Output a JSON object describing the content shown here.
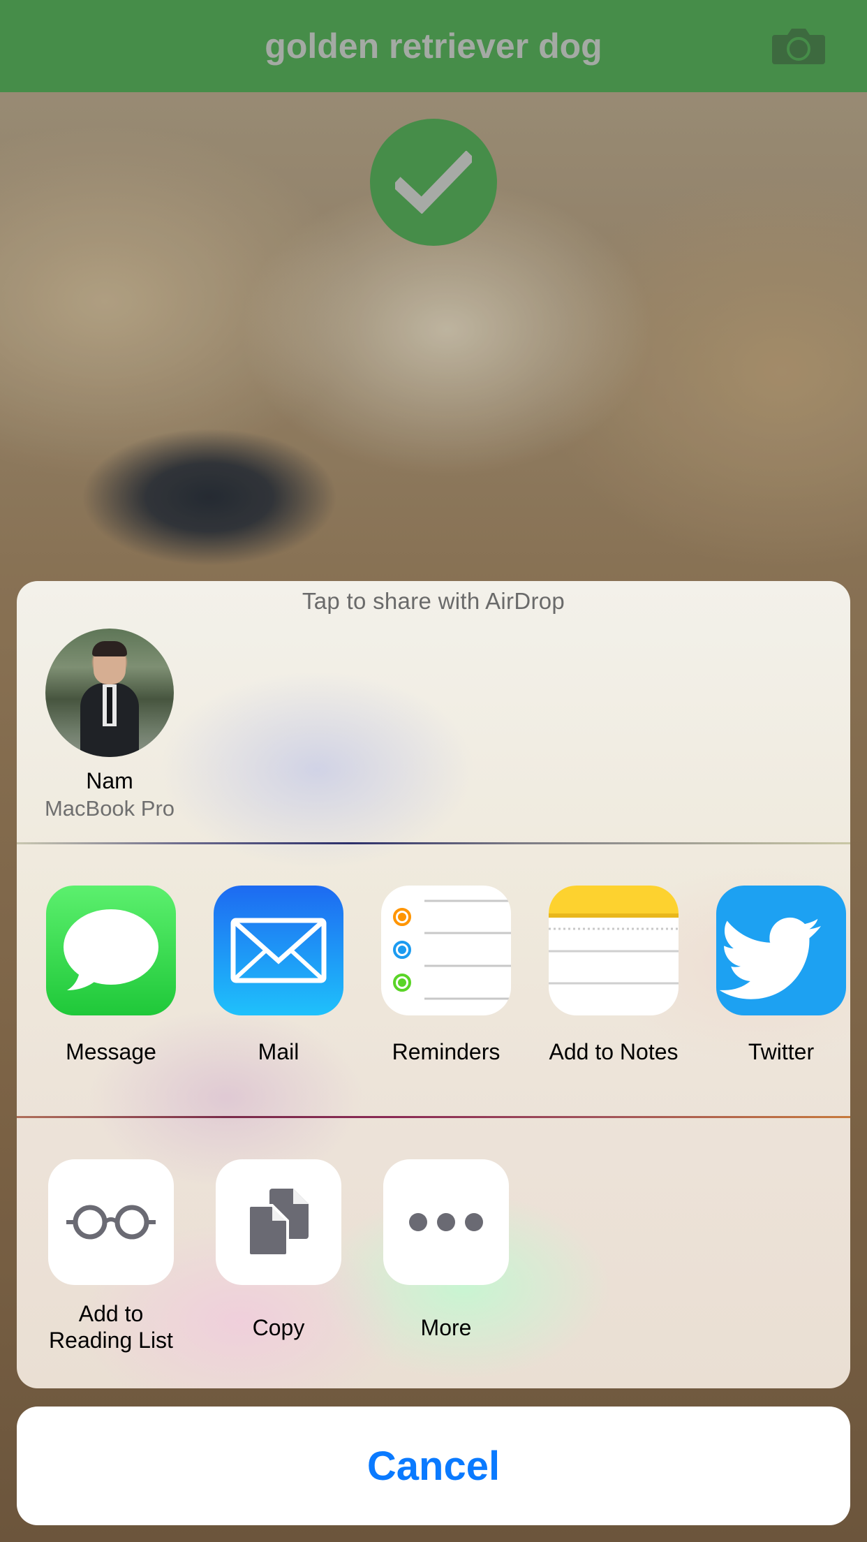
{
  "navbar": {
    "title": "golden retriever dog",
    "camera_icon": "camera-icon",
    "bg_color": "#468d49"
  },
  "status": {
    "badge_icon": "checkmark-icon"
  },
  "share_sheet": {
    "airdrop_title": "Tap to share with AirDrop",
    "airdrop_devices": [
      {
        "name": "Nam",
        "device": "MacBook Pro",
        "icon": "avatar"
      }
    ],
    "apps": [
      {
        "label": "Message",
        "icon": "messages-icon"
      },
      {
        "label": "Mail",
        "icon": "mail-icon"
      },
      {
        "label": "Reminders",
        "icon": "reminders-icon"
      },
      {
        "label": "Add to Notes",
        "icon": "notes-icon"
      },
      {
        "label": "Twitter",
        "icon": "twitter-icon"
      }
    ],
    "actions": [
      {
        "label_line1": "Add to",
        "label_line2": "Reading List",
        "icon": "reading-list-icon"
      },
      {
        "label": "Copy",
        "icon": "copy-icon"
      },
      {
        "label": "More",
        "icon": "more-icon"
      }
    ],
    "cancel_label": "Cancel",
    "accent_color": "#0a7aff"
  }
}
